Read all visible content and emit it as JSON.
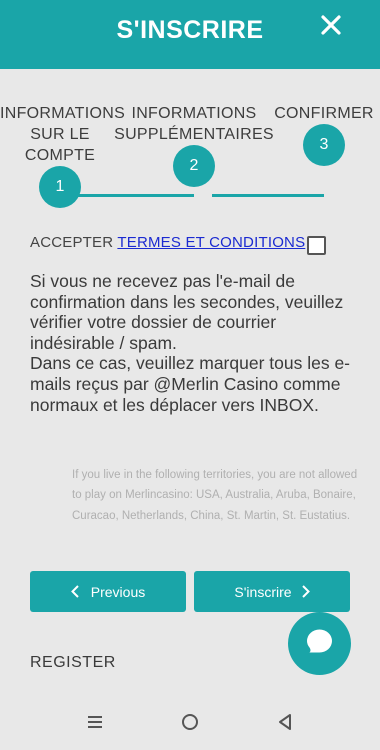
{
  "header": {
    "title": "S'INSCRIRE",
    "close_icon": "close-icon"
  },
  "steps": [
    {
      "number": "1",
      "label_lines": [
        "INFORMATIONS",
        "SUR LE",
        "COMPTE"
      ]
    },
    {
      "number": "2",
      "label_lines": [
        "INFORMATIONS",
        "SUPPLÉMENTAIRES"
      ]
    },
    {
      "number": "3",
      "label_lines": [
        "CONFIRMER"
      ]
    }
  ],
  "accept": {
    "prefix": "ACCEPTER",
    "link": "TERMES ET CONDITIONS",
    "checked": false
  },
  "message": {
    "paragraph1": "Si vous ne recevez pas l'e-mail de confirmation dans les secondes, veuillez vérifier votre dossier de courrier indésirable / spam.",
    "paragraph2": "Dans ce cas, veuillez marquer tous les e-mails reçus par @Merlin Casino comme normaux et les déplacer vers INBOX."
  },
  "territories": "If you live in the following territories, you are not allowed to play on Merlincasino: USA, Australia, Aruba, Bonaire, Curacao, Netherlands, China, St. Martin, St. Eustatius.",
  "buttons": {
    "previous": "Previous",
    "register": "S'inscrire"
  },
  "footer_register": "REGISTER",
  "colors": {
    "accent": "#1aa5a8",
    "background": "#e8e8e8",
    "link": "#1b2ad1"
  },
  "icons": {
    "chat": "chat-bubble-icon",
    "nav_menu": "menu-icon",
    "nav_home": "home-circle-icon",
    "nav_back": "back-triangle-icon"
  }
}
